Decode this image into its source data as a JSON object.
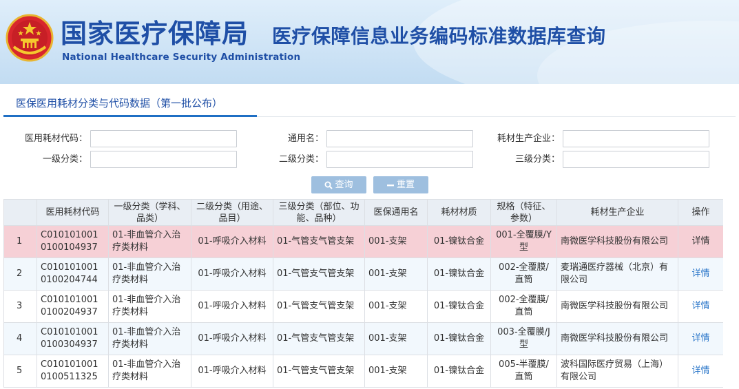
{
  "banner": {
    "brand_cn": "国家医疗保障局",
    "brand_en": "National Healthcare Security Administration",
    "subtitle": "医疗保障信息业务编码标准数据库查询",
    "emblem_icon": "national-emblem-icon"
  },
  "section": {
    "tab_label": "医保医用耗材分类与代码数据（第一批公布）"
  },
  "form": {
    "code_label": "医用耗材代码：",
    "code_value": "",
    "generic_label": "通用名：",
    "generic_value": "",
    "manufacturer_label": "耗材生产企业：",
    "manufacturer_value": "",
    "level1_label": "一级分类：",
    "level1_value": "",
    "level2_label": "二级分类：",
    "level2_value": "",
    "level3_label": "三级分类：",
    "level3_value": "",
    "search_label": "查询",
    "reset_label": "重置",
    "search_icon": "search-icon",
    "reset_icon": "minus-icon"
  },
  "colors": {
    "brand_blue": "#1f4fa6",
    "button_bg": "#9ebfdf",
    "highlight_row": "#f6d0d6",
    "alt_row": "#f2f8fd",
    "link": "#2a76c9"
  },
  "table": {
    "headers": [
      "",
      "医用耗材代码",
      "一级分类（学科、品类）",
      "二级分类（用途、品目）",
      "三级分类（部位、功能、品种）",
      "医保通用名",
      "耗材材质",
      "规格（特征、参数）",
      "耗材生产企业",
      "操作"
    ],
    "rows": [
      {
        "idx": "1",
        "code": "C010101001 0100104937",
        "l1": "01-非血管介入治疗类材料",
        "l2": "01-呼吸介入材料",
        "l3": "01-气管支气管支架",
        "generic": "001-支架",
        "material": "01-镍钛合金",
        "spec": "001-全覆膜/Y型",
        "company": "南微医学科技股份有限公司",
        "op": "详情"
      },
      {
        "idx": "2",
        "code": "C010101001 0100204744",
        "l1": "01-非血管介入治疗类材料",
        "l2": "01-呼吸介入材料",
        "l3": "01-气管支气管支架",
        "generic": "001-支架",
        "material": "01-镍钛合金",
        "spec": "002-全覆膜/直筒",
        "company": "麦瑞通医疗器械（北京）有限公司",
        "op": "详情"
      },
      {
        "idx": "3",
        "code": "C010101001 0100204937",
        "l1": "01-非血管介入治疗类材料",
        "l2": "01-呼吸介入材料",
        "l3": "01-气管支气管支架",
        "generic": "001-支架",
        "material": "01-镍钛合金",
        "spec": "002-全覆膜/直筒",
        "company": "南微医学科技股份有限公司",
        "op": "详情"
      },
      {
        "idx": "4",
        "code": "C010101001 0100304937",
        "l1": "01-非血管介入治疗类材料",
        "l2": "01-呼吸介入材料",
        "l3": "01-气管支气管支架",
        "generic": "001-支架",
        "material": "01-镍钛合金",
        "spec": "003-全覆膜/J型",
        "company": "南微医学科技股份有限公司",
        "op": "详情"
      },
      {
        "idx": "5",
        "code": "C010101001 0100511325",
        "l1": "01-非血管介入治疗类材料",
        "l2": "01-呼吸介入材料",
        "l3": "01-气管支气管支架",
        "generic": "001-支架",
        "material": "01-镍钛合金",
        "spec": "005-半覆膜/直筒",
        "company": "波科国际医疗贸易（上海）有限公司",
        "op": "详情"
      }
    ]
  }
}
